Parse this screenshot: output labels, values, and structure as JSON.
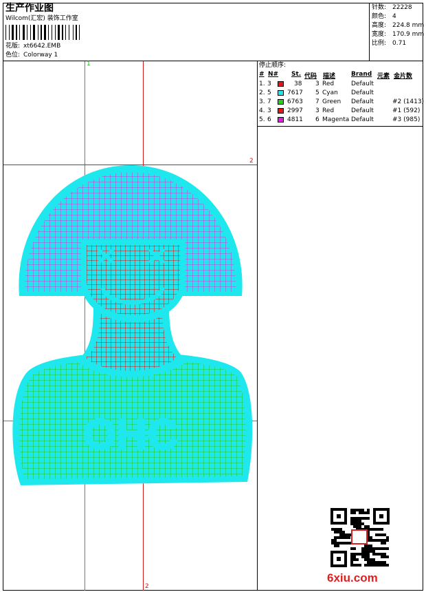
{
  "header": {
    "title": "生产作业图",
    "company": "Wilcom(汇宏) 装饰工作室",
    "design_label": "花版:",
    "design_value": "xt6642.EMB",
    "colorway_label": "色位:",
    "colorway_value": "Colorway 1"
  },
  "stats": [
    {
      "label": "针数:",
      "value": "22228"
    },
    {
      "label": "颜色:",
      "value": "4"
    },
    {
      "label": "高度:",
      "value": "224.8 mm"
    },
    {
      "label": "宽度:",
      "value": "170.9 mm"
    },
    {
      "label": "比例:",
      "value": "0.71"
    }
  ],
  "stop_sequence": {
    "title": "停止顺序:",
    "headers": [
      "#",
      "N#",
      "St.",
      "代码",
      "描述",
      "Brand",
      "元素",
      "金片数"
    ],
    "rows": [
      {
        "idx": "1.",
        "n": "3",
        "st": "38",
        "code": "3",
        "desc": "Red",
        "brand": "Default",
        "elem": "",
        "spangle": "",
        "color": "#e8141c"
      },
      {
        "idx": "2.",
        "n": "5",
        "st": "7617",
        "code": "5",
        "desc": "Cyan",
        "brand": "Default",
        "elem": "",
        "spangle": "",
        "color": "#1ee8ee"
      },
      {
        "idx": "3.",
        "n": "7",
        "st": "6763",
        "code": "7",
        "desc": "Green",
        "brand": "Default",
        "elem": "",
        "spangle": "#2 (1413)",
        "color": "#22d21e"
      },
      {
        "idx": "4.",
        "n": "3",
        "st": "2997",
        "code": "3",
        "desc": "Red",
        "brand": "Default",
        "elem": "",
        "spangle": "#1 (592)",
        "color": "#e8141c"
      },
      {
        "idx": "5.",
        "n": "6",
        "st": "4811",
        "code": "6",
        "desc": "Magenta",
        "brand": "Default",
        "elem": "",
        "spangle": "#3 (985)",
        "color": "#e020e0"
      }
    ]
  },
  "guides": {
    "v_top": "1",
    "h_right": "2",
    "v_bottom": "2"
  },
  "artwork": {
    "logo_text": "OHC"
  },
  "watermark": {
    "text": "6xiu.com"
  },
  "colors": {
    "cyan": "#1ee8ee",
    "magenta": "#d633d6",
    "red": "#e01010",
    "green": "#22cc22",
    "guide_red": "#d01818",
    "guide_green": "#22b422"
  }
}
